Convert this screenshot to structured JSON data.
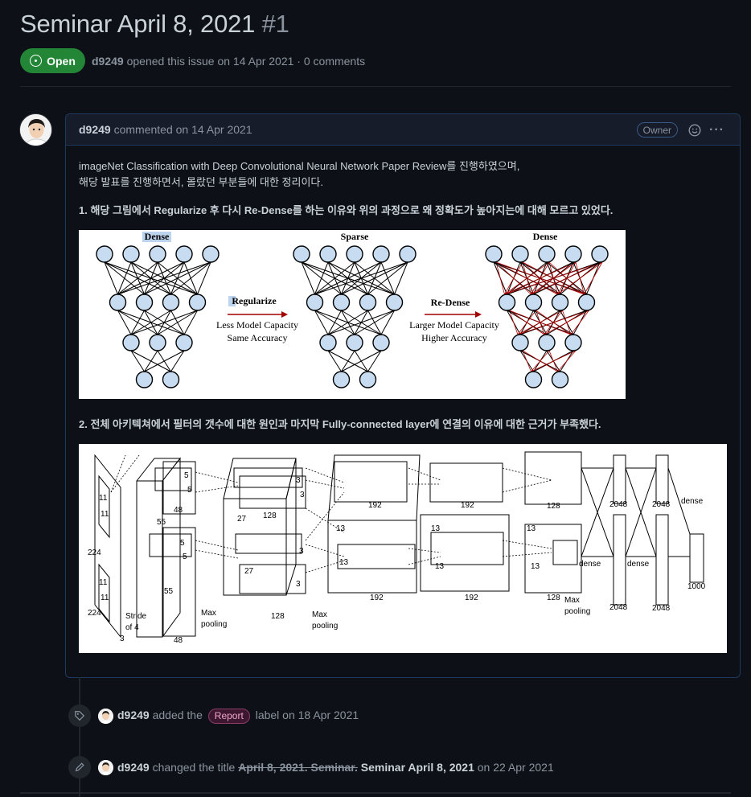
{
  "issue": {
    "title": "Seminar April 8, 2021",
    "number": "#1",
    "state": "Open",
    "author": "d9249",
    "meta_text": "opened this issue on 14 Apr 2021 · 0 comments"
  },
  "comment": {
    "author": "d9249",
    "meta_text": "commented on 14 Apr 2021",
    "badge": "Owner",
    "paragraph_line1": "imageNet Classification with Deep Convolutional Neural Network Paper Review를 진행하였으며,",
    "paragraph_line2": "해당 발표를 진행하면서, 몰랐던 부분들에 대한 정리이다.",
    "question1": "1. 해당 그림에서 Regularize 후 다시 Re-Dense를 하는 이유와 위의 과정으로 왜 정확도가 높아지는에 대해 모르고 있었다.",
    "question2": "2. 전체 아키텍쳐에서 필터의 갯수에 대한 원인과 마지막 Fully-connected layer에 연결의 이유에 대한 근거가 부족했다.",
    "figure1": {
      "dense_left": "Dense",
      "sparse": "Sparse",
      "dense_right": "Dense",
      "regularize": "Regularize",
      "regularize_sub1": "Less Model Capacity",
      "regularize_sub2": "Same Accuracy",
      "redense": "Re-Dense",
      "redense_sub1": "Larger Model Capacity",
      "redense_sub2": "Higher Accuracy"
    },
    "figure2": {
      "labels": {
        "n11a": "11",
        "n11b": "11",
        "n224a": "224",
        "n11c": "11",
        "n11d": "11",
        "n224b": "224",
        "stride": "Stride",
        "of4": "of 4",
        "n3": "3",
        "n55a": "55",
        "n55b": "55",
        "n5a": "5",
        "n5b": "5",
        "n5c": "5",
        "n5d": "5",
        "n48a": "48",
        "n48b": "48",
        "maxpool1a": "Max",
        "maxpool1b": "pooling",
        "n27a": "27",
        "n27b": "27",
        "n128a": "128",
        "n128b": "128",
        "n3a": "3",
        "n3b": "3",
        "n3c": "3",
        "n3d": "3",
        "maxpool2a": "Max",
        "maxpool2b": "pooling",
        "n192a": "192",
        "n192b": "192",
        "n13a": "13",
        "n13b": "13",
        "n192c": "192",
        "n192d": "192",
        "n128c": "128",
        "n128d": "128",
        "n13c": "13",
        "n13d": "13",
        "n13e": "13",
        "n13f": "13",
        "maxpool3a": "Max",
        "maxpool3b": "pooling",
        "n2048a": "2048",
        "n2048b": "2048",
        "n2048c": "2048",
        "n2048d": "2048",
        "densea": "dense",
        "denseb": "dense",
        "densec": "dense",
        "n1000": "1000"
      }
    }
  },
  "events": [
    {
      "actor": "d9249",
      "pre": "added the",
      "label": "Report",
      "post": "label on 18 Apr 2021"
    },
    {
      "actor": "d9249",
      "pre": "changed the title",
      "old_title": "April 8, 2021. Seminar.",
      "new_title": "Seminar April 8, 2021",
      "post": "on 22 Apr 2021"
    }
  ],
  "colors": {
    "open_green": "#238636",
    "background": "#0d1117",
    "comment_border": "#1f3a5f",
    "label_bg": "#3d1730"
  }
}
